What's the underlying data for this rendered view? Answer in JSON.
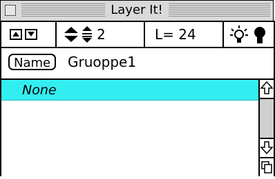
{
  "window": {
    "title": "Layer It!"
  },
  "toolbar": {
    "move_up_icon": "triangle-up",
    "move_down_icon": "triangle-down",
    "step_value": "2",
    "level_label": "L= 24",
    "show_icon": "lightbulb-on",
    "hide_icon": "lightbulb-off"
  },
  "name_row": {
    "button_label": "Name",
    "value": "Gruoppe1"
  },
  "list": {
    "items": [
      "None"
    ],
    "selected_index": 0,
    "selected_color": "#33eef0"
  },
  "scrollbar": {
    "up_icon": "scroll-up-arrow",
    "down_icon": "scroll-down-arrow",
    "grow_icon": "grow-box"
  }
}
